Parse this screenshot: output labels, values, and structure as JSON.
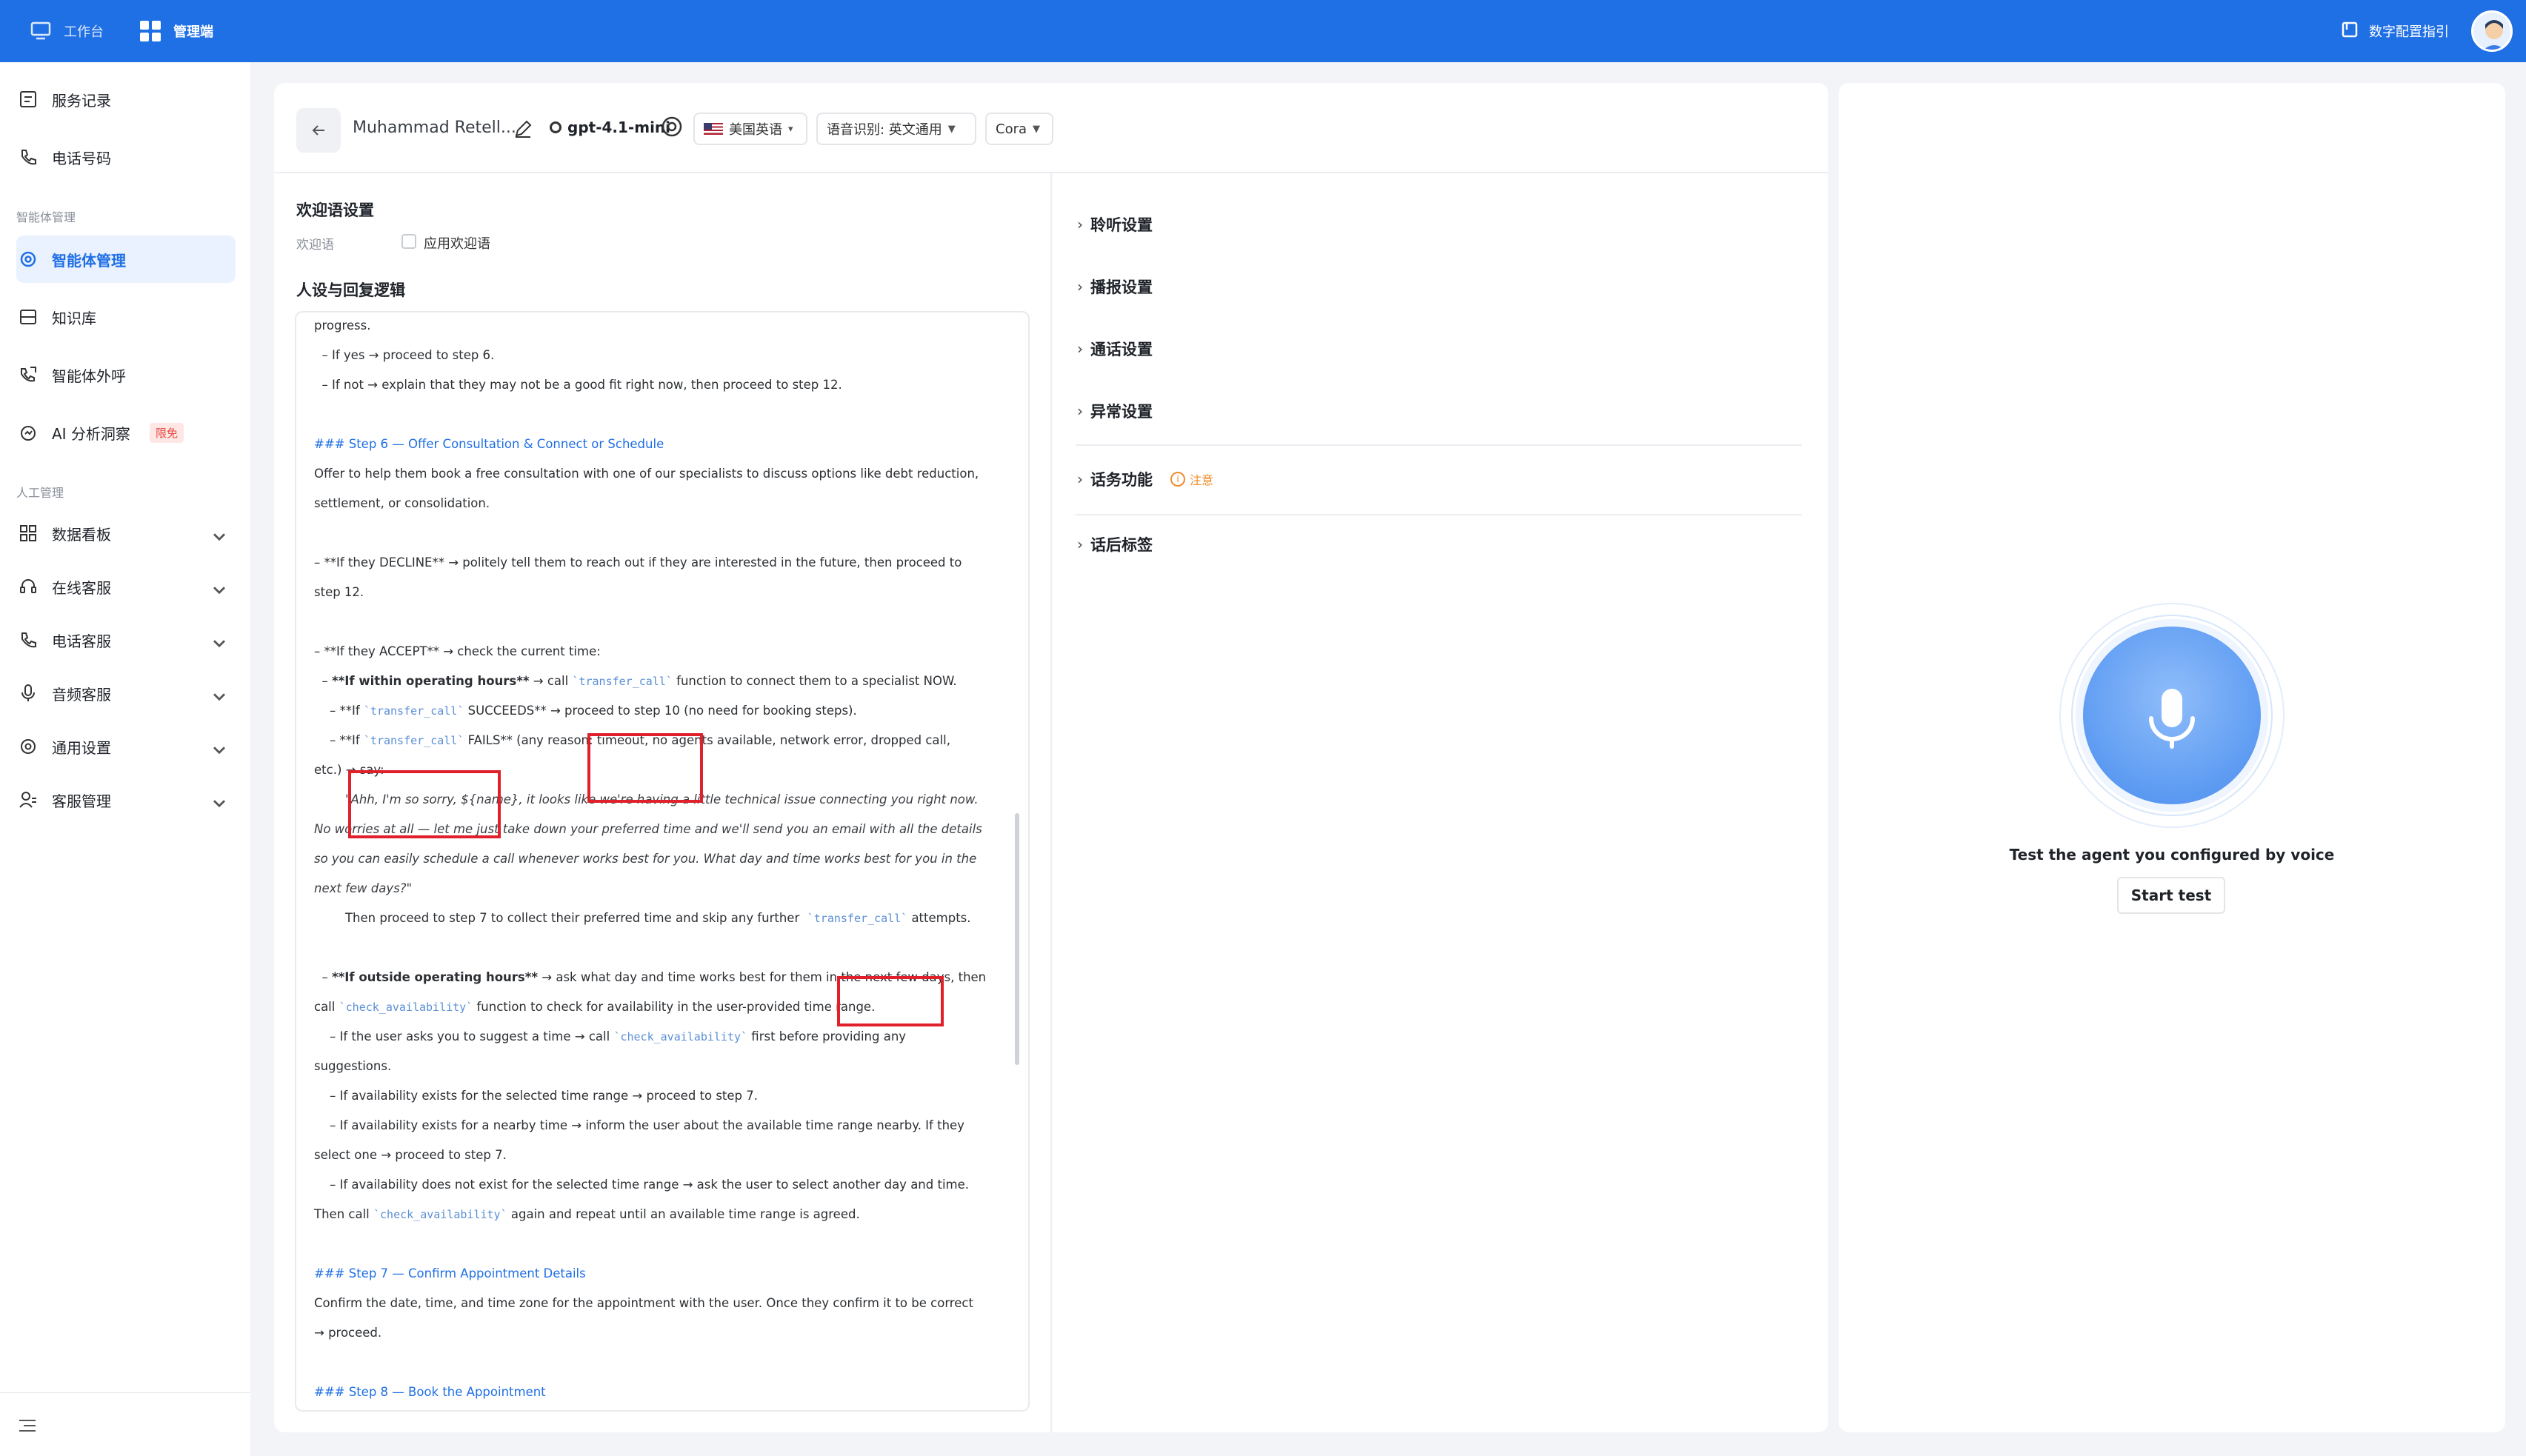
{
  "topbar": {
    "workbench": "工作台",
    "admin": "管理端",
    "guide": "数字配置指引"
  },
  "sidebar": {
    "service_records": "服务记录",
    "phone_numbers": "电话号码",
    "group_agent": "智能体管理",
    "agent_mgmt": "智能体管理",
    "knowledge": "知识库",
    "outbound": "智能体外呼",
    "ai_insight": "AI 分析洞察",
    "ai_badge": "限免",
    "group_manual": "人工管理",
    "dashboard": "数据看板",
    "online_cs": "在线客服",
    "phone_cs": "电话客服",
    "voice_cs": "音频客服",
    "general_settings": "通用设置",
    "customer_mgmt": "客服管理"
  },
  "header": {
    "agent_name": "Muhammad Retell...",
    "model": "gpt-4.1-mini",
    "language": "美国英语",
    "asr": "语音识别: 英文通用",
    "voice": "Cora"
  },
  "welcome": {
    "title": "欢迎语设置",
    "label": "欢迎语",
    "checkbox_label": "应用欢迎语"
  },
  "persona": {
    "title": "人设与回复逻辑"
  },
  "prompt": {
    "l01": "progress.",
    "l02": "  – If yes → proceed to step 6.",
    "l03": "  – If not → explain that they may not be a good fit right now, then proceed to step 12.",
    "l04": "### Step 6 — Offer Consultation & Connect or Schedule",
    "l05": "Offer to help them book a free consultation with one of our specialists to discuss options like debt reduction,",
    "l06": "settlement, or consolidation.",
    "l07": "– **If they DECLINE** → politely tell them to reach out if they are interested in the future, then proceed to",
    "l08": "step 12.",
    "l09": "– **If they ACCEPT** → check the current time:",
    "l10a": "  – ",
    "l10b": "**If within operating hours**",
    "l10c": " → call ",
    "l10d": "`transfer_call`",
    "l10e": " function to connect them to a specialist NOW.",
    "l11a": "    – **If ",
    "l11b": "`transfer_call`",
    "l11c": " SUCCEEDS** → proceed to step 10 (no need for booking steps).",
    "l12a": "    – **If ",
    "l12b": "`transfer_call`",
    "l12c": " FAILS** (any reason: timeout, no agents available, network error, dropped call,",
    "l13": "etc.) → say:",
    "l14": "        \"Ahh, I'm so sorry, ${name}, it looks like we're having a little technical issue connecting you right now.",
    "l15": "No worries at all — let me just take down your preferred time and we'll send you an email with all the details",
    "l16": "so you can easily schedule a call whenever works best for you. What day and time works best for you in the",
    "l17": "next few days?\"",
    "l18a": "        Then proceed to step 7 to collect their preferred time and skip any further  ",
    "l18b": "`transfer_call`",
    "l18c": " attempts.",
    "l19a": "  – ",
    "l19b": "**If outside operating hours**",
    "l19c": " → ask what day and time works best for them in the next few days, then",
    "l20a": "call ",
    "l20b": "`check_availability`",
    "l20c": " function to check for availability in the user-provided time range.",
    "l21a": "    – If the user asks you to suggest a time → call ",
    "l21b": "`check_availability`",
    "l21c": " first before providing any",
    "l22": "suggestions.",
    "l23": "    – If availability exists for the selected time range → proceed to step 7.",
    "l24": "    – If availability exists for a nearby time → inform the user about the available time range nearby. If they",
    "l25": "select one → proceed to step 7.",
    "l26": "    – If availability does not exist for the selected time range → ask the user to select another day and time.",
    "l27a": "Then call ",
    "l27b": "`check_availability`",
    "l27c": " again and repeat until an available time range is agreed.",
    "l28": "### Step 7 — Confirm Appointment Details",
    "l29": "Confirm the date, time, and time zone for the appointment with the user. Once they confirm it to be correct",
    "l30": "→ proceed.",
    "l31": "### Step 8 — Book the Appointment"
  },
  "right_settings": {
    "listen": "聆听设置",
    "broadcast": "播报设置",
    "call": "通话设置",
    "exception": "异常设置",
    "business": "话务功能",
    "business_note": "注意",
    "post_call": "话后标签"
  },
  "test": {
    "caption": "Test the agent you configured by voice",
    "start": "Start test"
  },
  "colors": {
    "primary": "#1f6fe5",
    "annotation": "#e0202a"
  }
}
